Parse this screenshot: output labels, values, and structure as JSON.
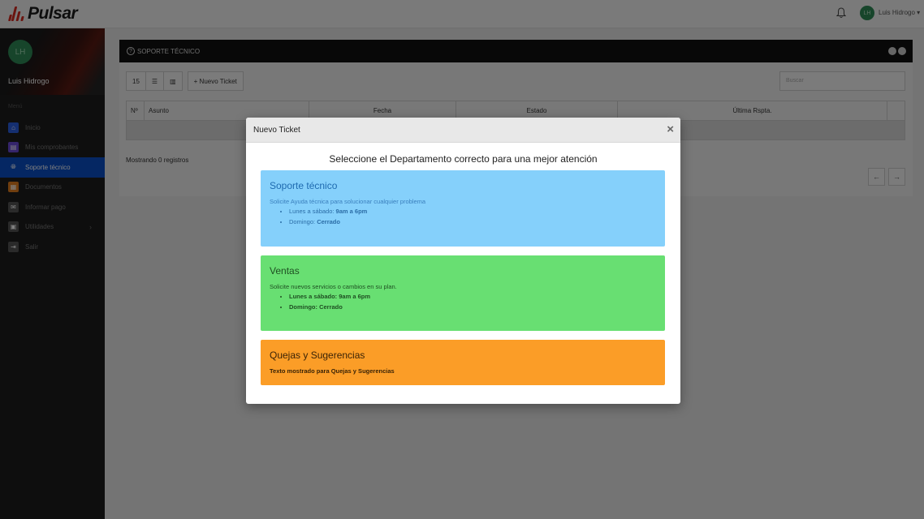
{
  "app": {
    "brand": "Pulsar",
    "accent": "#d6281f"
  },
  "topbar": {
    "user_initials": "LH",
    "user_name": "Luis Hidrogo ▾",
    "bell_icon": "bell-icon"
  },
  "sidebar": {
    "avatar_initials": "LH",
    "user_name": "Luis Hidrogo",
    "menu_label": "Menú",
    "items": [
      {
        "label": "Inicio",
        "icon": "home-icon",
        "color": "#2b5fe0"
      },
      {
        "label": "Mis comprobantes",
        "icon": "receipt-icon",
        "color": "#6a4bd6"
      },
      {
        "label": "Soporte técnico",
        "icon": "globe-icon",
        "color": "#0b4ec6"
      },
      {
        "label": "Documentos",
        "icon": "document-icon",
        "color": "#e07d1f"
      },
      {
        "label": "Informar pago",
        "icon": "mail-icon",
        "color": "#555555"
      },
      {
        "label": "Utilidades",
        "icon": "toolbox-icon",
        "color": "#555555"
      },
      {
        "label": "Salir",
        "icon": "logout-icon",
        "color": "#555555"
      }
    ]
  },
  "panel": {
    "title": "SOPORTE TÉCNICO",
    "page_size": "15",
    "new_ticket_label": "+ Nuevo Ticket",
    "search_placeholder": "Buscar",
    "columns": [
      "Nº",
      "Asunto",
      "Fecha",
      "Estado",
      "Última Rspta."
    ],
    "records_text": "Mostrando 0 registros",
    "prev": "←",
    "next": "→"
  },
  "modal": {
    "title": "Nuevo Ticket",
    "close": "×",
    "lead": "Seleccione el Departamento correcto para una mejor atención",
    "departments": [
      {
        "title": "Soporte técnico",
        "description": "Solicite Ayuda técnica para solucionar cualquier problema",
        "hours_label": "Lunes a sábado: ",
        "hours_value": "9am a 6pm",
        "sunday_label": "Domingo: ",
        "sunday_value": "Cerrado",
        "color": "#85d0fb"
      },
      {
        "title": "Ventas",
        "description": "Solicite nuevos servicios o cambios en su plan.",
        "hours_label": "Lunes a sábado: ",
        "hours_value": "9am a 6pm",
        "sunday_label": "Domingo: ",
        "sunday_value": "Cerrado",
        "color": "#68df72"
      },
      {
        "title": "Quejas y Sugerencias",
        "description": "Texto mostrado para Quejas y Sugerencias",
        "color": "#fb9d27"
      }
    ]
  }
}
